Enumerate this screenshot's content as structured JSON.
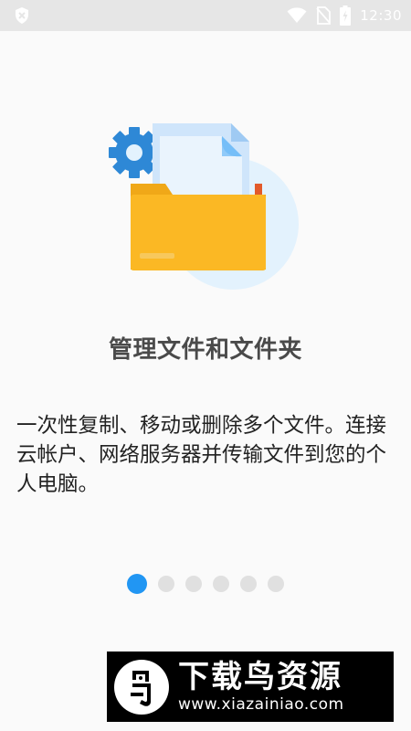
{
  "status_bar": {
    "time": "12:30",
    "left_icon": "shield-alert-icon",
    "icons": [
      "wifi-icon",
      "no-sim-icon",
      "battery-charging-icon"
    ]
  },
  "onboarding": {
    "illustration": "folder-with-documents-and-gear-icon",
    "title": "管理文件和文件夹",
    "description": "一次性复制、移动或删除多个文件。连接云帐户、网络服务器并传输文件到您的个人电脑。",
    "page_indicator": {
      "total": 6,
      "current": 1,
      "active_color": "#2196f3",
      "inactive_color": "#e0e0e0"
    }
  },
  "watermark": {
    "title": "下载鸟资源",
    "url": "www.xiazainiao.com"
  },
  "colors": {
    "folder": "#fbb824",
    "gear": "#2e88d6",
    "circle": "#e3f2fd"
  }
}
